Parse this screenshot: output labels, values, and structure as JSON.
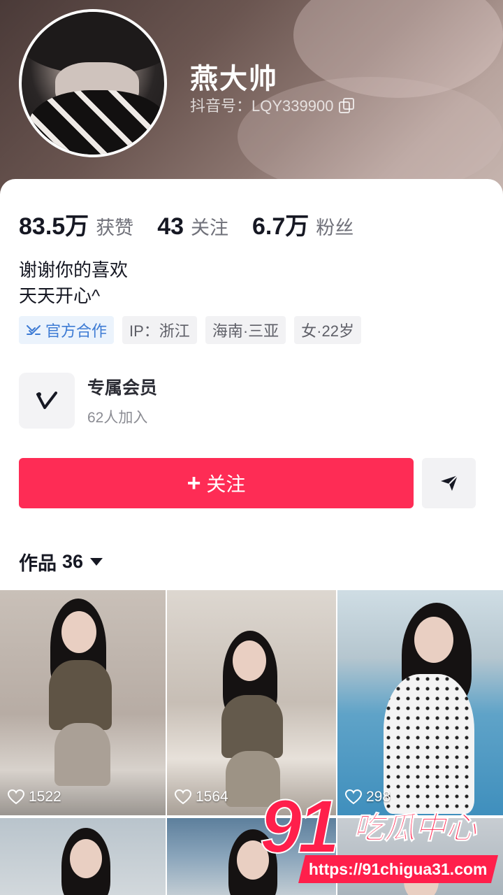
{
  "profile": {
    "nickname": "燕大帅",
    "douyin_id": "抖音号：LQY339900"
  },
  "stats": [
    {
      "value": "83.5万",
      "label": "获赞"
    },
    {
      "value": "43",
      "label": "关注"
    },
    {
      "value": "6.7万",
      "label": "粉丝"
    }
  ],
  "bio": [
    "谢谢你的喜欢",
    "天天开心^"
  ],
  "tags": {
    "official": "官方合作",
    "ip": "IP：浙江",
    "location": "海南·三亚",
    "gender_age": "女·22岁"
  },
  "member": {
    "title": "专属会员",
    "subtitle": "62人加入"
  },
  "actions": {
    "follow_label": "关注",
    "share_icon": "send-icon"
  },
  "works": {
    "label": "作品",
    "count": "36",
    "items": [
      {
        "likes": "1522"
      },
      {
        "likes": "1564"
      },
      {
        "likes": "298"
      }
    ]
  },
  "watermark": {
    "number": "91",
    "text": "吃瓜中心",
    "url": "https://91chigua31.com"
  },
  "colors": {
    "accent": "#fe2c55",
    "official_tag": "#3d7bd4"
  }
}
